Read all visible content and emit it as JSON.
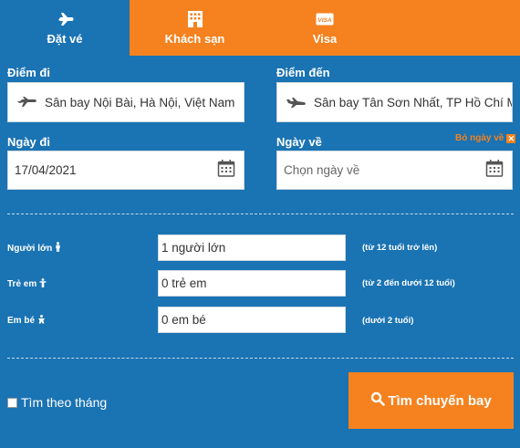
{
  "tabs": [
    {
      "label": "Đặt vé",
      "icon": "plane-icon",
      "active": true
    },
    {
      "label": "Khách sạn",
      "icon": "hotel-icon",
      "active": false
    },
    {
      "label": "Visa",
      "icon": "visa-card-icon",
      "active": false
    }
  ],
  "origin": {
    "label": "Điểm đi",
    "value": "Sân bay Nội Bài, Hà Nội, Việt Nam"
  },
  "destination": {
    "label": "Điểm đến",
    "value": "Sân bay Tân Sơn Nhất, TP Hồ Chí Minh"
  },
  "depart_date": {
    "label": "Ngày đi",
    "value": "17/04/2021"
  },
  "return_date": {
    "label": "Ngày về",
    "placeholder": "Chọn ngày về",
    "clear_label": "Bỏ ngày về",
    "clear_icon": "✕"
  },
  "passengers": [
    {
      "label": "Người lớn",
      "value": "1 người lớn",
      "note": "(từ 12 tuổi trở lên)",
      "icon": "adult-icon"
    },
    {
      "label": "Trẻ em",
      "value": "0 trẻ em",
      "note": "(từ 2 đến dưới 12 tuổi)",
      "icon": "child-icon"
    },
    {
      "label": "Em bé",
      "value": "0 em bé",
      "note": "(dưới 2 tuổi)",
      "icon": "infant-icon"
    }
  ],
  "month_search": {
    "label": "Tìm theo tháng",
    "checked": false
  },
  "search_button": {
    "label": "Tìm chuyến bay",
    "icon": "search-icon"
  },
  "colors": {
    "primary_blue": "#1a73b3",
    "accent_orange": "#f5821f"
  }
}
